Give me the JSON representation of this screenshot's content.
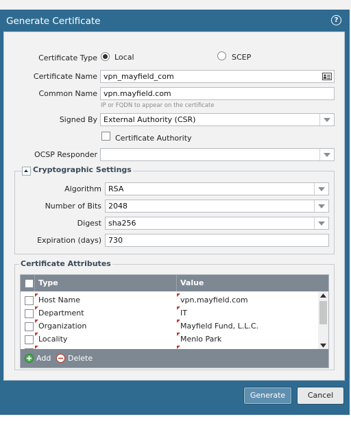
{
  "dialog": {
    "title": "Generate Certificate",
    "help_icon": "question-icon"
  },
  "form": {
    "certificate_type": {
      "label": "Certificate Type",
      "options": [
        "Local",
        "SCEP"
      ],
      "selected": "Local"
    },
    "certificate_name": {
      "label": "Certificate Name",
      "value": "vpn_mayfield_com"
    },
    "common_name": {
      "label": "Common Name",
      "value": "vpn.mayfield.com",
      "hint": "IP or FQDN to appear on the certificate"
    },
    "signed_by": {
      "label": "Signed By",
      "value": "External Authority (CSR)"
    },
    "certificate_authority": {
      "label": "Certificate Authority",
      "checked": false
    },
    "ocsp_responder": {
      "label": "OCSP Responder",
      "value": ""
    }
  },
  "crypto": {
    "title": "Cryptographic Settings",
    "algorithm": {
      "label": "Algorithm",
      "value": "RSA"
    },
    "bits": {
      "label": "Number of Bits",
      "value": "2048"
    },
    "digest": {
      "label": "Digest",
      "value": "sha256"
    },
    "expiration": {
      "label": "Expiration (days)",
      "value": "730"
    }
  },
  "attributes": {
    "title": "Certificate Attributes",
    "columns": [
      "Type",
      "Value"
    ],
    "rows": [
      {
        "type": "Host Name",
        "value": "vpn.mayfield.com"
      },
      {
        "type": "Department",
        "value": "IT"
      },
      {
        "type": "Organization",
        "value": "Mayfield Fund, L.L.C."
      },
      {
        "type": "Locality",
        "value": "Menlo Park"
      }
    ],
    "add_label": "Add",
    "delete_label": "Delete"
  },
  "buttons": {
    "generate": "Generate",
    "cancel": "Cancel"
  },
  "colors": {
    "titlebar": "#2f6b91",
    "body": "#f2f2f2",
    "grid_header": "#7d8893"
  }
}
